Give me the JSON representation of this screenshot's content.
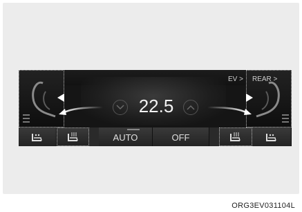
{
  "climate": {
    "temperature": "22.5",
    "ev_label": "EV >",
    "rear_label": "REAR >",
    "auto_label": "AUTO",
    "off_label": "OFF",
    "image_code": "ORG3EV031104L"
  },
  "icons": {
    "left_seat": "driver-seat-icon",
    "right_seat": "passenger-seat-icon",
    "temp_down": "chevron-down-icon",
    "temp_up": "chevron-up-icon",
    "seat_heat": "seat-heat-icon",
    "seat_vent": "seat-ventilation-icon"
  },
  "colors": {
    "panel": "#151515",
    "text": "#f2f2f2",
    "accent_line": "#bdbdbd"
  }
}
